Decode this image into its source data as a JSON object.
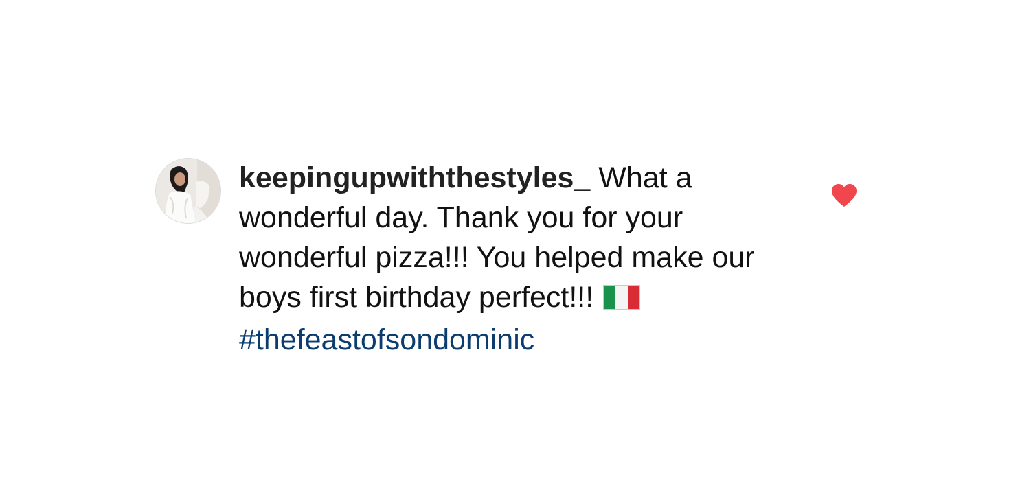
{
  "comment": {
    "username": "keepingupwiththestyles_",
    "text": "What a wonderful day. Thank you for your wonderful pizza!!! You helped make our boys first birthday perfect!!!",
    "emoji": "flag-italy",
    "hashtag": "#thefeastofsondominic",
    "liked": true,
    "heart_color": "#f0464c",
    "hashtag_color": "#0b3d6e"
  }
}
